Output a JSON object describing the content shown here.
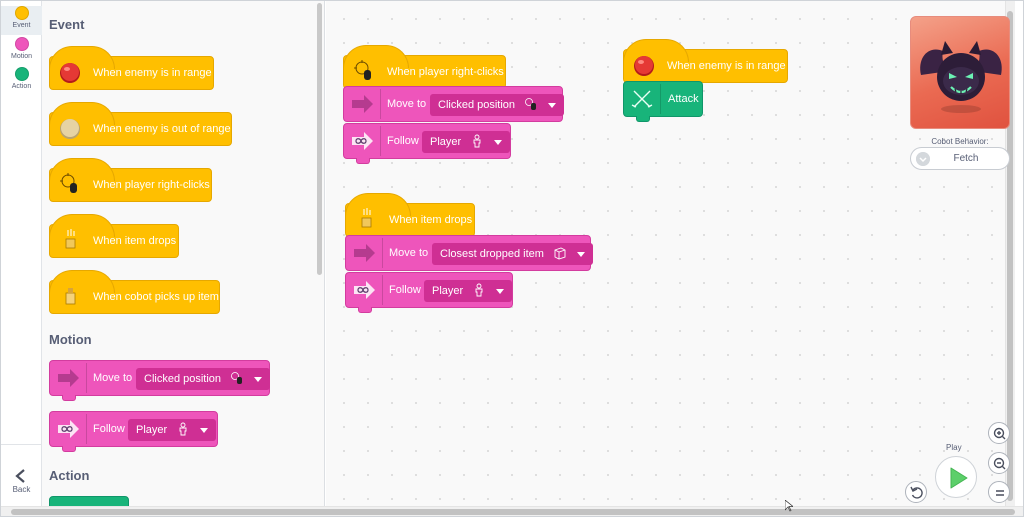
{
  "rail": {
    "categories": [
      {
        "label": "Event",
        "color": "#ffbf00"
      },
      {
        "label": "Motion",
        "color": "#ee55bb"
      },
      {
        "label": "Action",
        "color": "#18b47a"
      }
    ],
    "back_label": "Back",
    "back_icon": "chevron-left-icon"
  },
  "palette": {
    "event_title": "Event",
    "event_blocks": [
      {
        "label": "When enemy is in range",
        "icon": "red-button-icon"
      },
      {
        "label": "When enemy is out of range",
        "icon": "beige-button-icon"
      },
      {
        "label": "When player right-clicks",
        "icon": "mouse-click-icon"
      },
      {
        "label": "When item drops",
        "icon": "item-drop-icon"
      },
      {
        "label": "When cobot picks up item",
        "icon": "bottle-icon"
      }
    ],
    "motion_title": "Motion",
    "motion_blocks": [
      {
        "label": "Move to",
        "value": "Clicked position",
        "icon": "arrow-right-icon",
        "value_icon": "mouse-click-icon"
      },
      {
        "label": "Follow",
        "value": "Player",
        "icon": "infinity-arrow-icon",
        "value_icon": "person-icon"
      }
    ],
    "action_title": "Action"
  },
  "workspace": {
    "script1": {
      "hat": "When player right-clicks",
      "move_label": "Move to",
      "move_value": "Clicked position",
      "follow_label": "Follow",
      "follow_value": "Player"
    },
    "script2": {
      "hat": "When item drops",
      "move_label": "Move to",
      "move_value": "Closest dropped item",
      "follow_label": "Follow",
      "follow_value": "Player"
    },
    "script3": {
      "hat": "When enemy is in range",
      "action_label": "Attack"
    }
  },
  "preview": {
    "behavior_label": "Cobot Behavior:",
    "behavior_value": "Fetch",
    "character": "bat-cobot"
  },
  "controls": {
    "play_label": "Play",
    "zoom_in_icon": "zoom-in-icon",
    "zoom_out_icon": "zoom-out-icon",
    "reset_zoom_icon": "equals-icon",
    "undo_icon": "undo-icon"
  },
  "colors": {
    "event": "#ffbf00",
    "motion": "#ee55bb",
    "action": "#18b47a",
    "dropdown": "#cf2f94"
  }
}
